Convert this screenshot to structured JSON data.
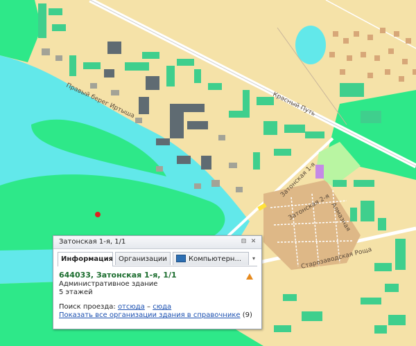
{
  "map": {
    "labels": {
      "riverbank": "Правый берег Иртыша",
      "krasny_put": "Красный Путь",
      "street_1": "Затонская 1-я",
      "street_2": "Затонская 2-я",
      "street_3": "Алмазная",
      "street_4": "Старозаводская Роща"
    },
    "colors": {
      "land": "#f5e2a8",
      "water": "#62e8ea",
      "park": "#2ee889",
      "building": "#3fcf8d",
      "building_dark": "#5f6b72",
      "house": "#d7a778",
      "district": "#deb887",
      "marker": "#e02020"
    }
  },
  "popup": {
    "title": "Затонская 1-я, 1/1",
    "tabs": [
      "Информация",
      "Организации",
      "Компьютерн..."
    ],
    "address": "644033, Затонская 1-я, 1/1",
    "type": "Административное здание",
    "floors": "5 этажей",
    "route_label": "Поиск проезда:",
    "route_from": "отсюда",
    "route_dash": "–",
    "route_to": "сюда",
    "show_all_link": "Показать все организации здания в справочнике",
    "count": "(9)"
  }
}
